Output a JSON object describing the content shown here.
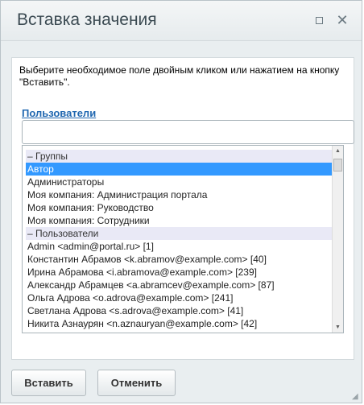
{
  "dialog": {
    "title": "Вставка значения",
    "description": "Выберите необходимое поле двойным кликом или нажатием на кнопку \"Вставить\".",
    "section_link": "Пользователи",
    "search": {
      "value": "",
      "placeholder": ""
    },
    "list": [
      {
        "label": "– Группы",
        "kind": "group"
      },
      {
        "label": "Автор",
        "kind": "item",
        "selected": true
      },
      {
        "label": "Администраторы",
        "kind": "item"
      },
      {
        "label": "Моя компания: Администрация портала",
        "kind": "item"
      },
      {
        "label": "Моя компания: Руководство",
        "kind": "item"
      },
      {
        "label": "Моя компания: Сотрудники",
        "kind": "item"
      },
      {
        "label": "– Пользователи",
        "kind": "group"
      },
      {
        "label": "Admin <admin@portal.ru> [1]",
        "kind": "item"
      },
      {
        "label": "Константин Абрамов <k.abramov@example.com> [40]",
        "kind": "item"
      },
      {
        "label": "Ирина Абрамова <i.abramova@example.com> [239]",
        "kind": "item"
      },
      {
        "label": "Александр Абрамцев <a.abramcev@example.com> [87]",
        "kind": "item"
      },
      {
        "label": "Ольга Адрова <o.adrova@example.com> [241]",
        "kind": "item"
      },
      {
        "label": "Светлана Адрова <s.adrova@example.com> [41]",
        "kind": "item"
      },
      {
        "label": "Никита Азнаурян <n.aznauryan@example.com> [42]",
        "kind": "item"
      }
    ],
    "insert_label": "Вставить",
    "cancel_label": "Отменить"
  },
  "icons": {
    "maximize": "maximize-icon",
    "close": "close-icon"
  },
  "colors": {
    "selected": "#3399ff",
    "group": "#e9e9f6",
    "link": "#2067b0"
  }
}
